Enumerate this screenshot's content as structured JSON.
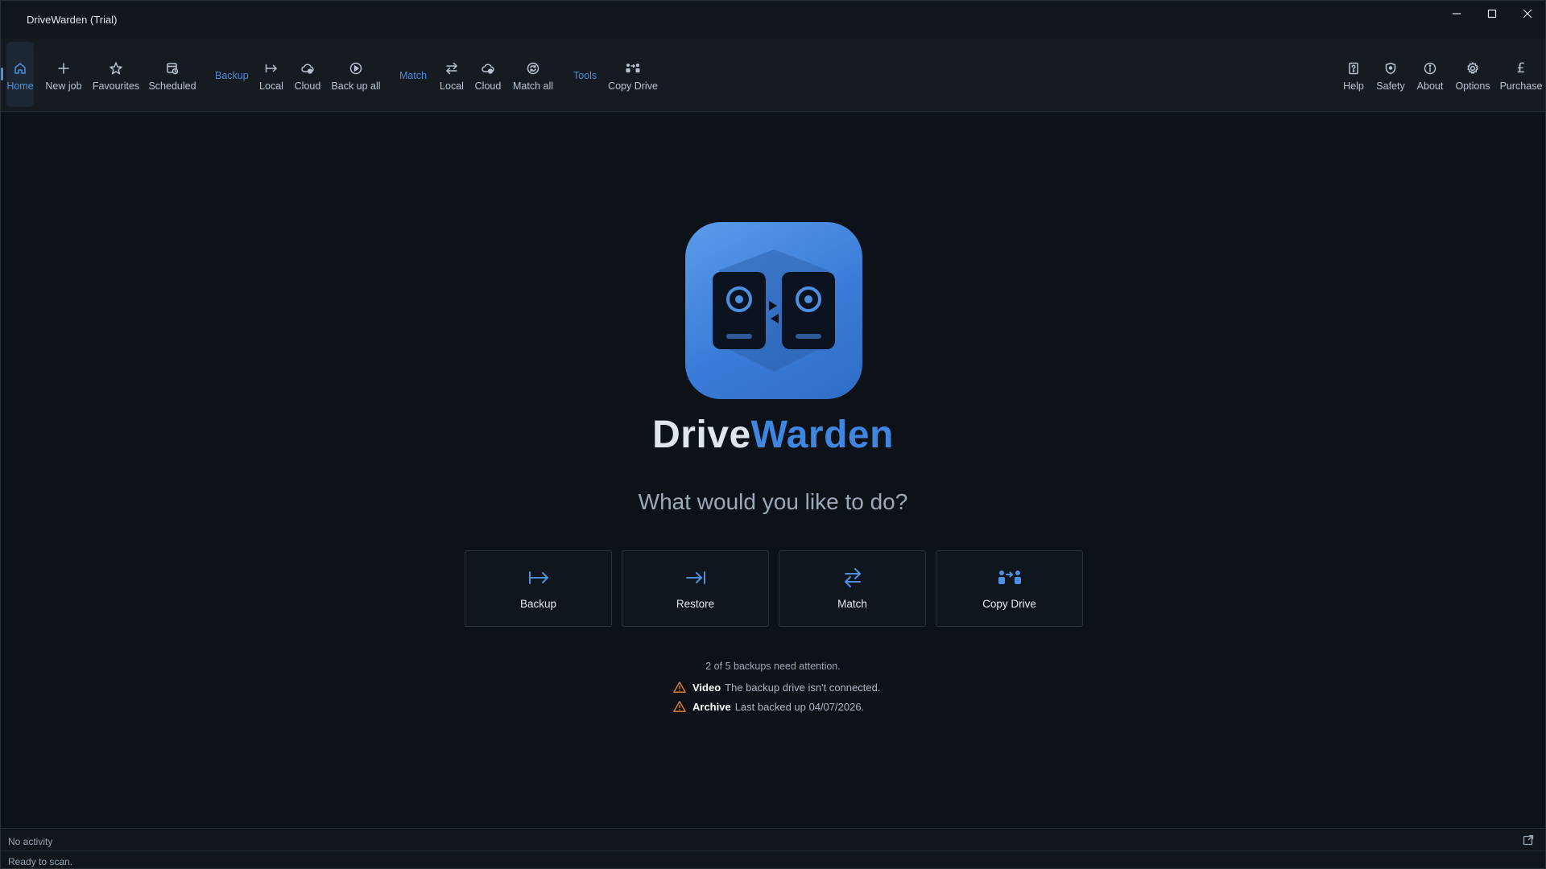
{
  "window": {
    "title": "DriveWarden (Trial)"
  },
  "ribbon": {
    "home": {
      "label": "Home",
      "icon": "home-icon"
    },
    "new_job": {
      "label": "New job",
      "icon": "plus-icon"
    },
    "favourites": {
      "label": "Favourites",
      "icon": "star-icon"
    },
    "scheduled": {
      "label": "Scheduled",
      "icon": "calendar-clock-icon"
    },
    "backup_group": "Backup",
    "backup_local": {
      "label": "Local",
      "icon": "arrow-to-bar-icon"
    },
    "backup_cloud": {
      "label": "Cloud",
      "icon": "cloud-icon"
    },
    "back_up_all": {
      "label": "Back up all",
      "icon": "play-circle-icon"
    },
    "match_group": "Match",
    "match_local": {
      "label": "Local",
      "icon": "swap-arrows-icon"
    },
    "match_cloud": {
      "label": "Cloud",
      "icon": "cloud-icon"
    },
    "match_all": {
      "label": "Match all",
      "icon": "sync-circle-icon"
    },
    "tools_group": "Tools",
    "copy_drive": {
      "label": "Copy Drive",
      "icon": "copy-drive-icon"
    },
    "help": {
      "label": "Help",
      "icon": "help-icon"
    },
    "safety": {
      "label": "Safety",
      "icon": "shield-icon"
    },
    "about": {
      "label": "About",
      "icon": "info-icon"
    },
    "options": {
      "label": "Options",
      "icon": "gear-icon"
    },
    "purchase": {
      "label": "Purchase",
      "icon": "pound-icon",
      "glyph": "£"
    }
  },
  "main": {
    "brand_part1": "Drive",
    "brand_part2": "Warden",
    "question": "What would you like to do?",
    "actions": [
      {
        "label": "Backup",
        "icon": "arrow-to-bar-icon"
      },
      {
        "label": "Restore",
        "icon": "arrow-into-bar-icon"
      },
      {
        "label": "Match",
        "icon": "swap-arrows-icon"
      },
      {
        "label": "Copy Drive",
        "icon": "copy-drive-icon"
      }
    ],
    "attention_summary": "2 of 5 backups need attention.",
    "alerts": [
      {
        "name": "Video",
        "message": "The backup drive isn't connected."
      },
      {
        "name": "Archive",
        "message": "Last backed up 04/07/2026."
      }
    ]
  },
  "status": {
    "activity": "No activity",
    "scan": "Ready to scan."
  },
  "colors": {
    "accent": "#4d8fe0",
    "brand_blue": "#3f86e0",
    "warning": "#e8833a",
    "background": "#0d1218"
  }
}
